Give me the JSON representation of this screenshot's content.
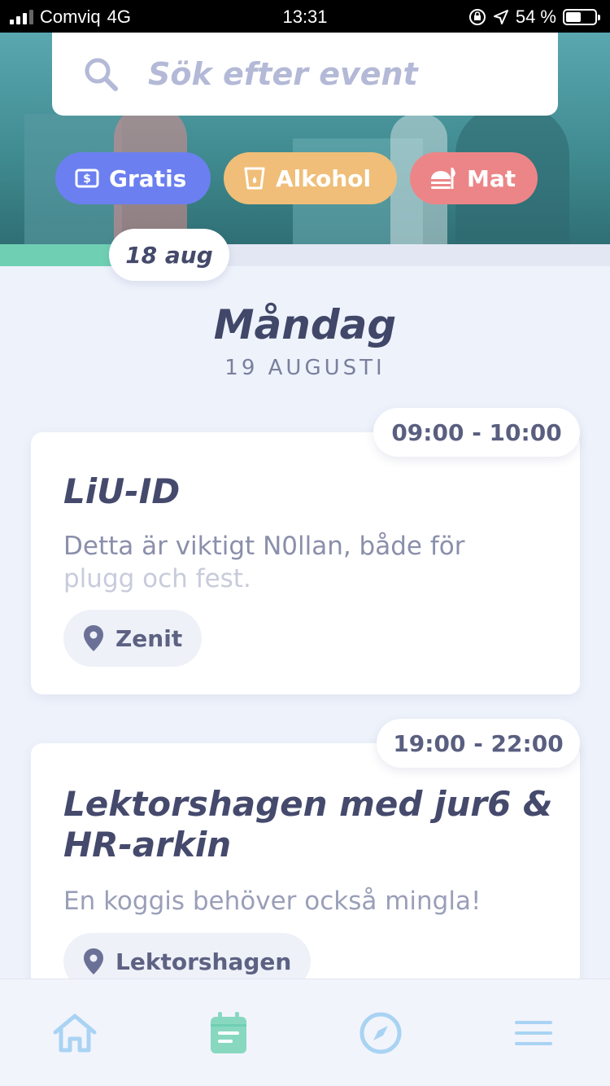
{
  "status_bar": {
    "carrier": "Comviq",
    "network": "4G",
    "time": "13:31",
    "battery_percent": "54 %",
    "battery_level": 0.54
  },
  "search": {
    "placeholder": "Sök efter event",
    "icon": "search-icon"
  },
  "filters": [
    {
      "label": "Gratis",
      "icon": "money-icon",
      "color": "#6b7ff0"
    },
    {
      "label": "Alkohol",
      "icon": "drink-icon",
      "color": "#f0be78"
    },
    {
      "label": "Mat",
      "icon": "food-icon",
      "color": "#ec8587"
    }
  ],
  "date_pill": "18 aug",
  "day": {
    "title": "Måndag",
    "subtitle": "19 AUGUSTI"
  },
  "events": [
    {
      "time": "09:00 - 10:00",
      "title": "LiU-ID",
      "description_line1": "Detta är viktigt N0llan, både för",
      "description_line2": "plugg och fest.",
      "location": "Zenit"
    },
    {
      "time": "19:00 - 22:00",
      "title_line1": "Lektorshagen med jur6 &",
      "title_line2": "HR-arkin",
      "description_line1": "En koggis behöver också mingla!",
      "location": "Lektorshagen"
    }
  ],
  "tabbar": [
    {
      "icon": "home-icon",
      "active": false
    },
    {
      "icon": "calendar-icon",
      "active": true
    },
    {
      "icon": "compass-icon",
      "active": false
    },
    {
      "icon": "menu-icon",
      "active": false
    }
  ],
  "colors": {
    "accent_green": "#6fcfb2",
    "tab_inactive": "#a9d3f3",
    "text_dark": "#454a6d"
  }
}
